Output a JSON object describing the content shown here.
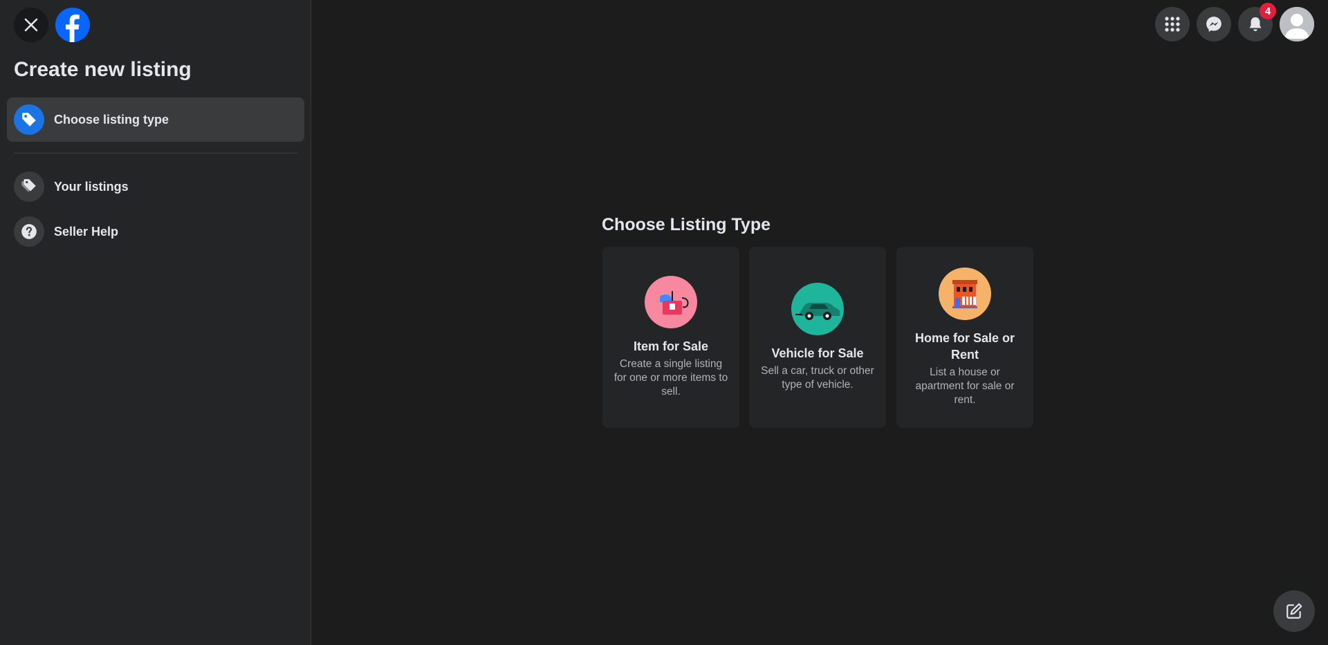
{
  "sidebar": {
    "title": "Create new listing",
    "items": [
      {
        "label": "Choose listing type",
        "icon": "tag-icon",
        "active": true
      },
      {
        "label": "Your listings",
        "icon": "tags-icon",
        "active": false
      },
      {
        "label": "Seller Help",
        "icon": "question-icon",
        "active": false
      }
    ]
  },
  "topbar": {
    "notifications_count": "4",
    "icons": [
      "menu-grid-icon",
      "messenger-icon",
      "bell-icon",
      "avatar"
    ]
  },
  "main": {
    "heading": "Choose Listing Type",
    "cards": [
      {
        "title": "Item for Sale",
        "description": "Create a single listing for one or more items to sell.",
        "color": "#f7889f"
      },
      {
        "title": "Vehicle for Sale",
        "description": "Sell a car, truck or other type of vehicle.",
        "color": "#1fb59d"
      },
      {
        "title": "Home for Sale or Rent",
        "description": "List a house or apartment for sale or rent.",
        "color": "#f7b26a"
      }
    ]
  },
  "colors": {
    "accent": "#1b74e4",
    "badge": "#e41e3f",
    "background": "#1c1c1d",
    "panel": "#242526"
  }
}
